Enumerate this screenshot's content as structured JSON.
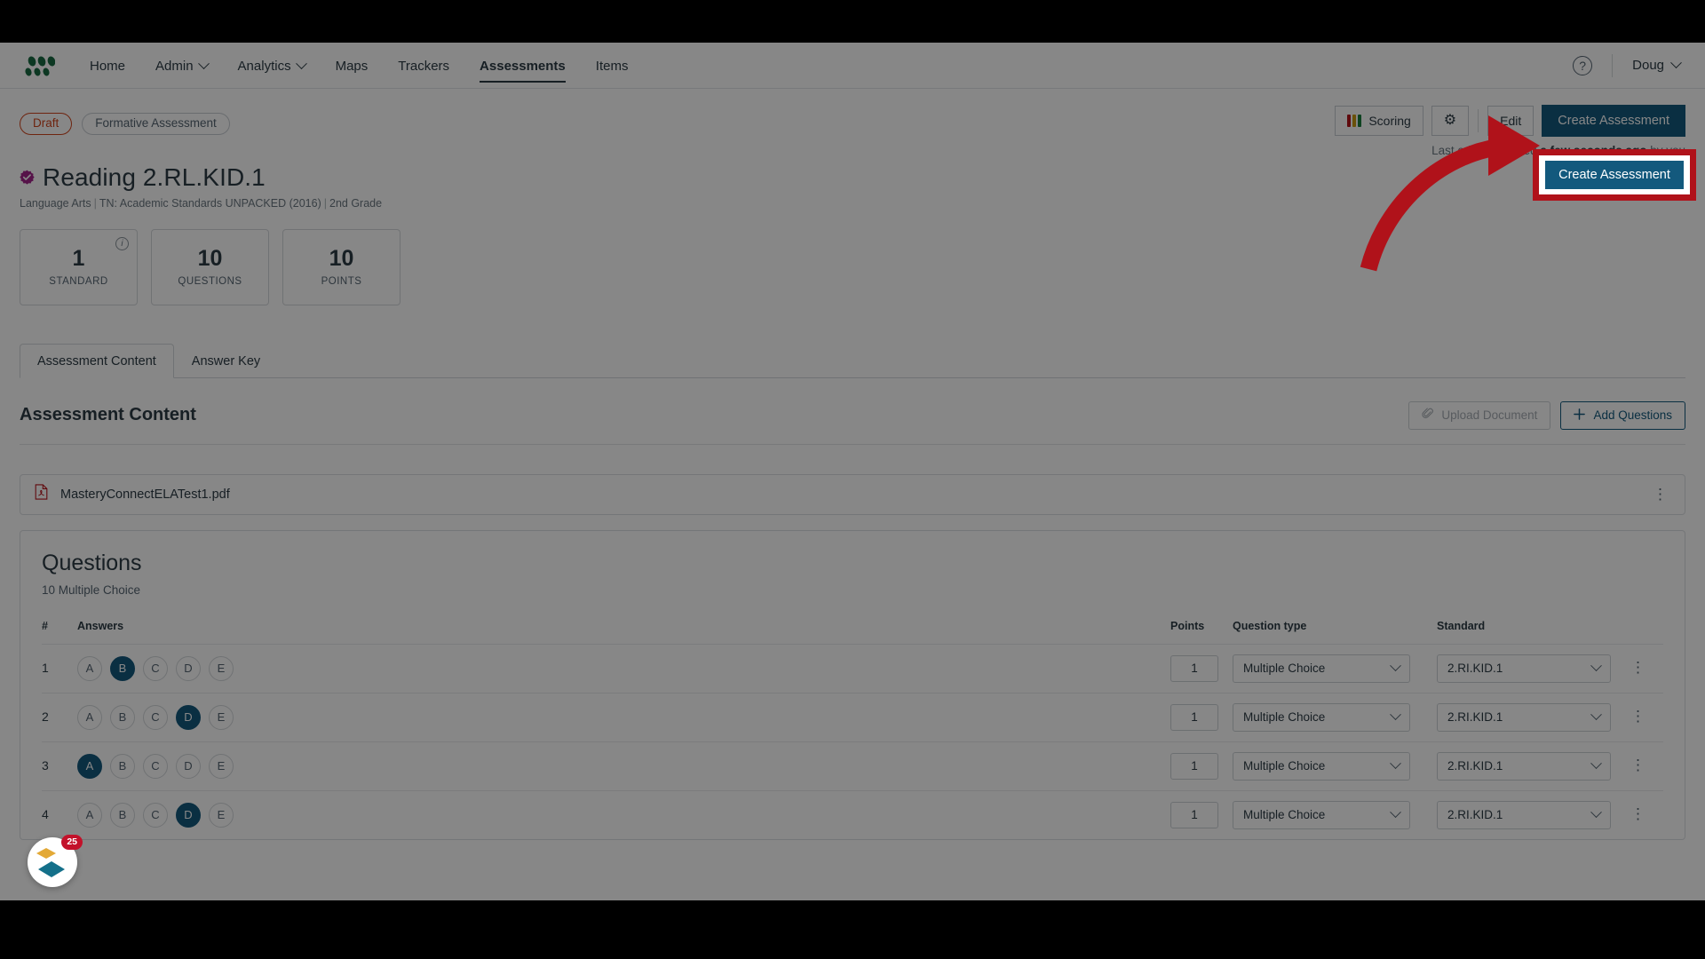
{
  "nav": {
    "logo_icon": "masteryconnect-logo",
    "links": [
      {
        "label": "Home",
        "caret": false,
        "active": false
      },
      {
        "label": "Admin",
        "caret": true,
        "active": false
      },
      {
        "label": "Analytics",
        "caret": true,
        "active": false
      },
      {
        "label": "Maps",
        "caret": false,
        "active": false
      },
      {
        "label": "Trackers",
        "caret": false,
        "active": false
      },
      {
        "label": "Assessments",
        "caret": false,
        "active": true
      },
      {
        "label": "Items",
        "caret": false,
        "active": false
      }
    ],
    "help_icon": "question-mark-icon",
    "help_label": "?",
    "user": "Doug"
  },
  "status": {
    "draft": "Draft",
    "type": "Formative Assessment",
    "draft_color": "#d0451d"
  },
  "toolbar": {
    "scoring_label": "Scoring",
    "scoring_bar_colors": [
      "#b4131a",
      "#c99a12",
      "#1c7d3e"
    ],
    "gear_icon": "gear-icon",
    "gear_label": "⚙",
    "obscured_button_label": "Edit",
    "create_label": "Create Assessment",
    "create_bg": "#13597d",
    "last_edit_prefix": "Last edit was saved ",
    "last_edit_time": "a few seconds ago",
    "last_edit_suffix": " by you"
  },
  "header": {
    "badge_icon": "verified-badge-icon",
    "title": "Reading 2.RL.KID.1",
    "subject": "Language Arts",
    "standard_set": "TN: Academic Standards UNPACKED (2016)",
    "grade": "2nd Grade"
  },
  "stats": [
    {
      "num": "1",
      "label": "STANDARD",
      "info": true,
      "info_label": "i"
    },
    {
      "num": "10",
      "label": "QUESTIONS",
      "info": false
    },
    {
      "num": "10",
      "label": "POINTS",
      "info": false
    }
  ],
  "tabs": [
    {
      "label": "Assessment Content",
      "active": true
    },
    {
      "label": "Answer Key",
      "active": false
    }
  ],
  "section": {
    "title": "Assessment Content",
    "upload_label": "Upload Document",
    "upload_icon": "paperclip-icon",
    "add_label": "Add Questions",
    "add_icon": "plus-icon"
  },
  "file": {
    "icon": "pdf-file-icon",
    "name": "MasteryConnectELATest1.pdf",
    "menu_icon": "kebab-menu-icon"
  },
  "questions": {
    "title": "Questions",
    "subtitle": "10 Multiple Choice",
    "columns": {
      "num": "#",
      "answers": "Answers",
      "points": "Points",
      "qtype": "Question type",
      "standard": "Standard"
    },
    "choices": [
      "A",
      "B",
      "C",
      "D",
      "E"
    ],
    "rows": [
      {
        "num": "1",
        "selected": "B",
        "points": "1",
        "qtype": "Multiple Choice",
        "standard": "2.RI.KID.1"
      },
      {
        "num": "2",
        "selected": "D",
        "points": "1",
        "qtype": "Multiple Choice",
        "standard": "2.RI.KID.1"
      },
      {
        "num": "3",
        "selected": "A",
        "points": "1",
        "qtype": "Multiple Choice",
        "standard": "2.RI.KID.1"
      },
      {
        "num": "4",
        "selected": "D",
        "points": "1",
        "qtype": "Multiple Choice",
        "standard": "2.RI.KID.1"
      }
    ]
  },
  "widget": {
    "icon": "diamond-badges-icon",
    "count": "25"
  },
  "annotation": {
    "arrow_color": "#b0121a",
    "highlight_color": "#b0121a"
  }
}
